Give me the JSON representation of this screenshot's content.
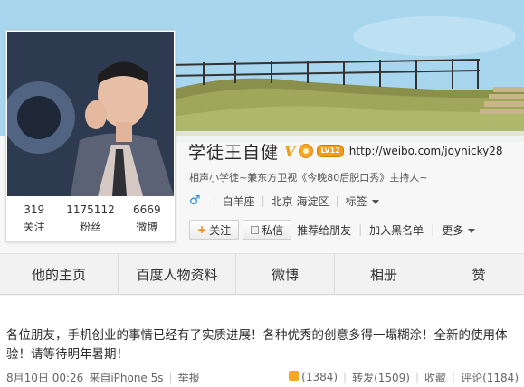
{
  "profile": {
    "name": "学徒王自健",
    "verified_badge": "V",
    "level_badge": "LV12",
    "website": "http://weibo.com/joynicky28",
    "intro": "相声小学徒~兼东方卫视《今晚80后脱口秀》主持人~",
    "gender_symbol": "♂",
    "zodiac": "白羊座",
    "location": "北京 海淀区",
    "tags_label": "标签",
    "stats": [
      {
        "value": "319",
        "label": "关注"
      },
      {
        "value": "1175112",
        "label": "粉丝"
      },
      {
        "value": "6669",
        "label": "微博"
      }
    ]
  },
  "actions": {
    "follow": "关注",
    "follow_plus": "+",
    "message": "私信",
    "recommend": "推荐给朋友",
    "blacklist": "加入黑名单",
    "more": "更多"
  },
  "tabs": [
    {
      "label": "他的主页"
    },
    {
      "label": "百度人物资料"
    },
    {
      "label": "微博"
    },
    {
      "label": "相册"
    },
    {
      "label": "赞"
    }
  ],
  "post": {
    "text": "各位朋友，手机创业的事情已经有了实质进展！各种优秀的创意多得一塌糊涂！全新的使用体验！请等待明年暑期！",
    "date": "8月10日 00:26",
    "source": "来自iPhone 5s",
    "report": "举报",
    "likes": "(1384)",
    "reposts": "转发(1509)",
    "favorite": "收藏",
    "comments": "评论(1184)"
  },
  "colors": {
    "accent_orange": "#f0820f",
    "verified_gold": "#f09d12",
    "gender_blue": "#2a8ad6"
  }
}
